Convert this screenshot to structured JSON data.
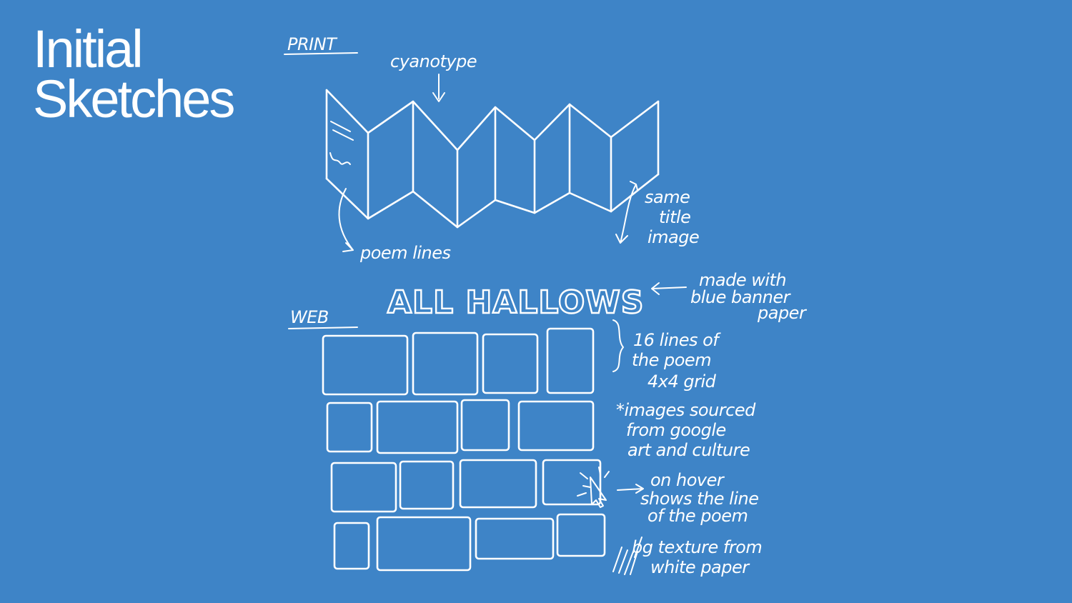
{
  "slide": {
    "title_line1": "Initial",
    "title_line2": "Sketches",
    "background_color": "#3E84C7",
    "ink_color": "#FFFFFF"
  },
  "sketch": {
    "print_section": {
      "heading": "PRINT",
      "annotation_top": "cyanotype",
      "annotation_left": "poem lines",
      "annotation_right": [
        "same",
        "title",
        "image"
      ]
    },
    "web_section": {
      "heading": "WEB",
      "banner_title": "ALL HALLOWS",
      "banner_note": [
        "made with",
        "blue banner",
        "paper"
      ],
      "grid_note": [
        "16 lines of",
        "the poem",
        "4x4 grid"
      ],
      "images_note": [
        "*images sourced",
        "from google",
        "art and culture"
      ],
      "hover_note": [
        "on hover",
        "shows the line",
        "of the poem"
      ],
      "texture_note": [
        "bg texture from",
        "white paper"
      ]
    }
  }
}
